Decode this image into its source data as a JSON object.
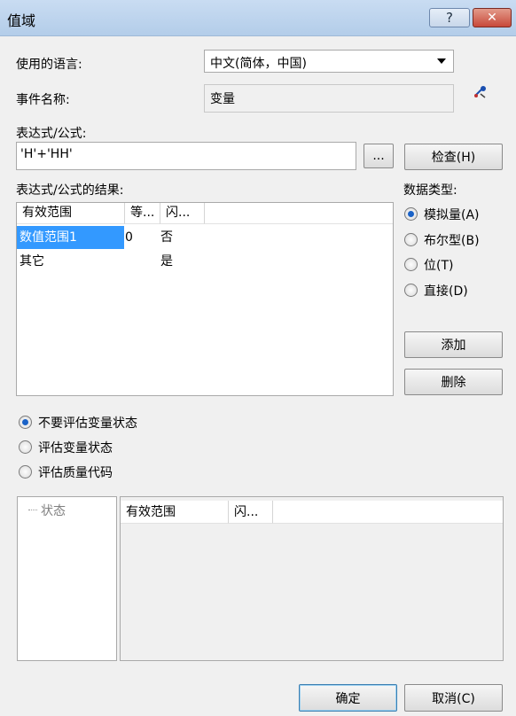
{
  "window": {
    "title": "值域",
    "help_label": "?",
    "close_label": "✕"
  },
  "language": {
    "label": "使用的语言:",
    "value": "中文(简体，中国)"
  },
  "event": {
    "label": "事件名称:",
    "value": "变量"
  },
  "expression": {
    "label": "表达式/公式:",
    "value": "'H'+'HH'",
    "browse_label": "...",
    "check_label": "检查(H)"
  },
  "results": {
    "label": "表达式/公式的结果:",
    "columns": [
      "有效范围",
      "等...",
      "闪..."
    ],
    "rows": [
      {
        "range": "数值范围1",
        "equal": "0",
        "blink": "否"
      },
      {
        "range": "其它",
        "equal": "",
        "blink": "是"
      }
    ]
  },
  "data_type": {
    "label": "数据类型:",
    "options": [
      "模拟量(A)",
      "布尔型(B)",
      "位(T)",
      "直接(D)"
    ],
    "selected": 0
  },
  "actions": {
    "add_label": "添加",
    "delete_label": "删除"
  },
  "evaluation": {
    "options": [
      "不要评估变量状态",
      "评估变量状态",
      "评估质量代码"
    ],
    "selected": 0
  },
  "status_tree": {
    "item": "状态"
  },
  "status_table": {
    "columns": [
      "有效范围",
      "闪..."
    ]
  },
  "footer": {
    "ok_label": "确定",
    "cancel_label": "取消(C)"
  },
  "colors": {
    "selection": "#3399ff",
    "radio_dot": "#1a62c7"
  }
}
